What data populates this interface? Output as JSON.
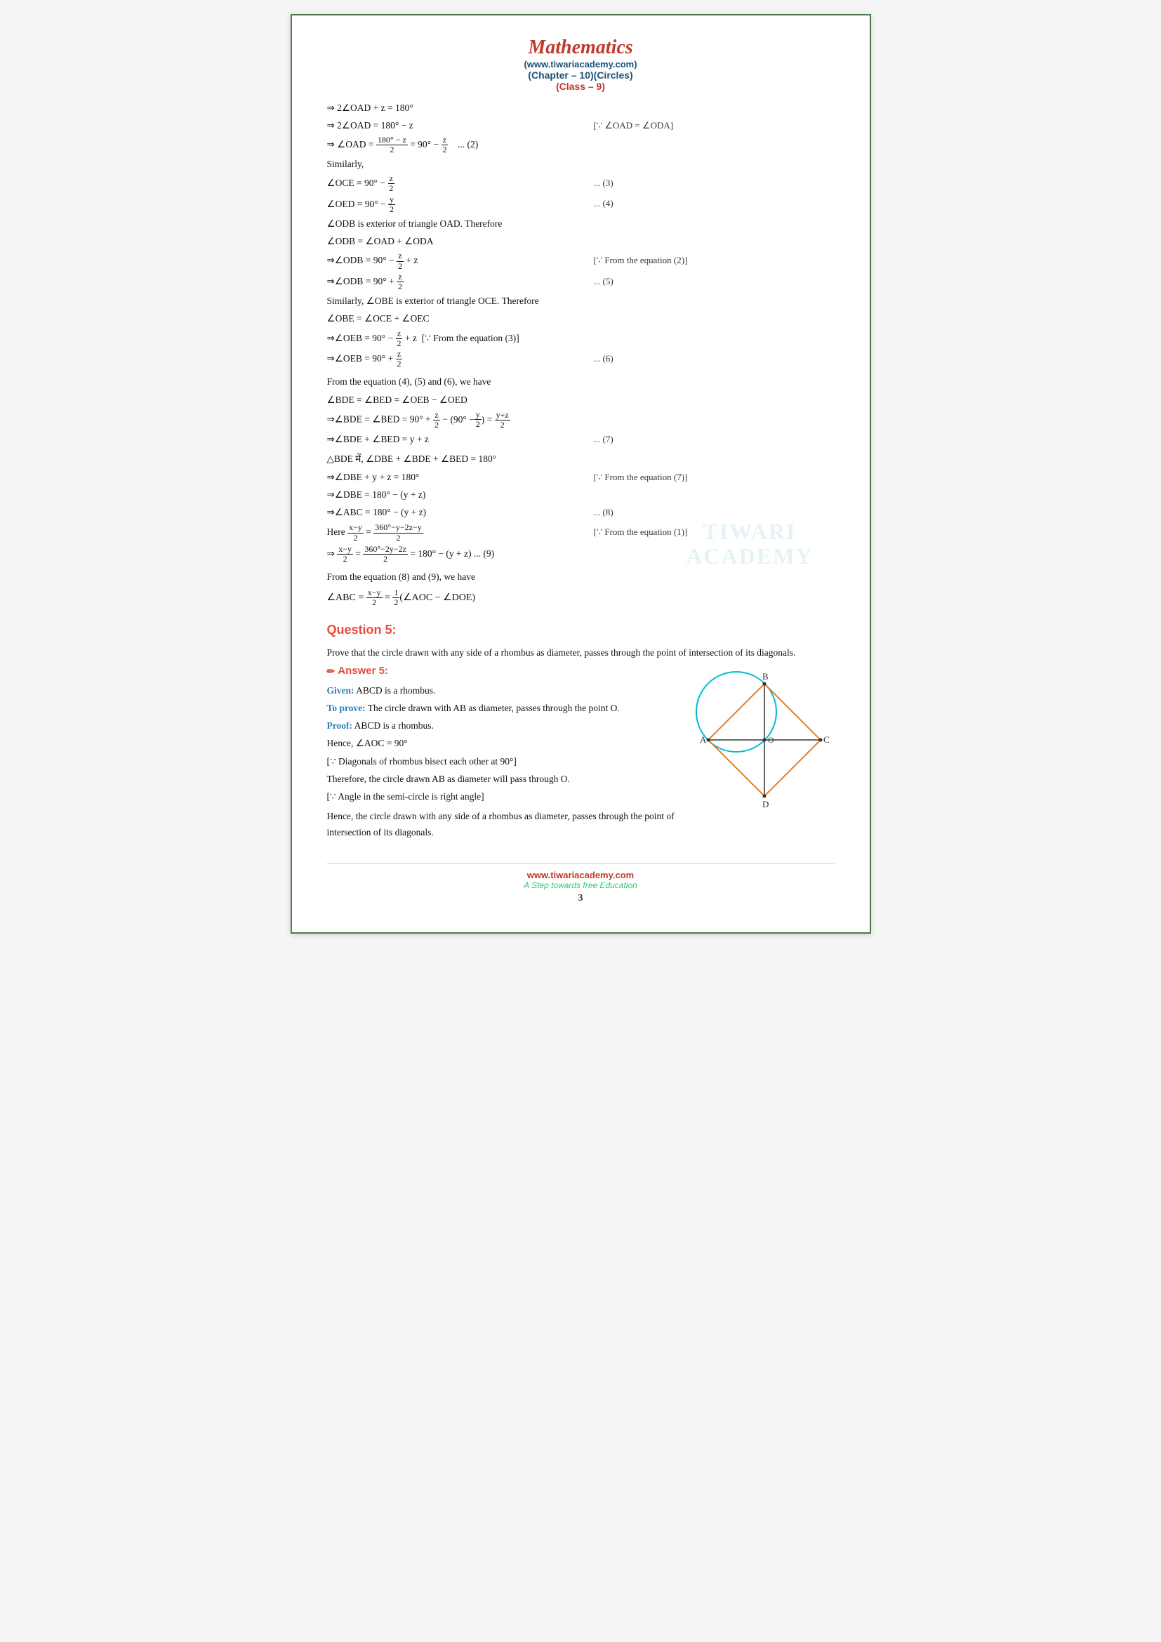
{
  "header": {
    "title": "Mathematics",
    "subtitle": "(www.tiwariacademy.com)",
    "chapter": "(Chapter – 10)(Circles)",
    "class_label": "(Class – 9)"
  },
  "watermark": {
    "line1": "TIWARI",
    "line2": "ACADEMY"
  },
  "footer": {
    "url": "www.tiwariacademy.com",
    "tagline": "A Step towards free Education",
    "page": "3"
  },
  "question5": {
    "heading": "Question 5:",
    "text": "Prove that the circle drawn with any side of a rhombus as diameter, passes through the point of intersection of its diagonals.",
    "answer_heading": "Answer 5:",
    "given_label": "Given:",
    "given_text": " ABCD is a rhombus.",
    "toprove_label": "To prove:",
    "toprove_text": " The circle drawn with AB as diameter, passes through the point O.",
    "proof_label": "Proof:",
    "proof_text": " ABCD is a rhombus.",
    "hence_text": "Hence, ∠AOC = 90°",
    "diagonals_text": "[∵ Diagonals of rhombus bisect each other at 90°]",
    "therefore_text": "Therefore, the circle drawn AB as diameter will pass through O.",
    "angle_text": "[∵ Angle in the semi-circle is right angle]",
    "hence2_text": "Hence, the circle drawn with any side of a rhombus as diameter, passes through the point of intersection of its diagonals."
  }
}
